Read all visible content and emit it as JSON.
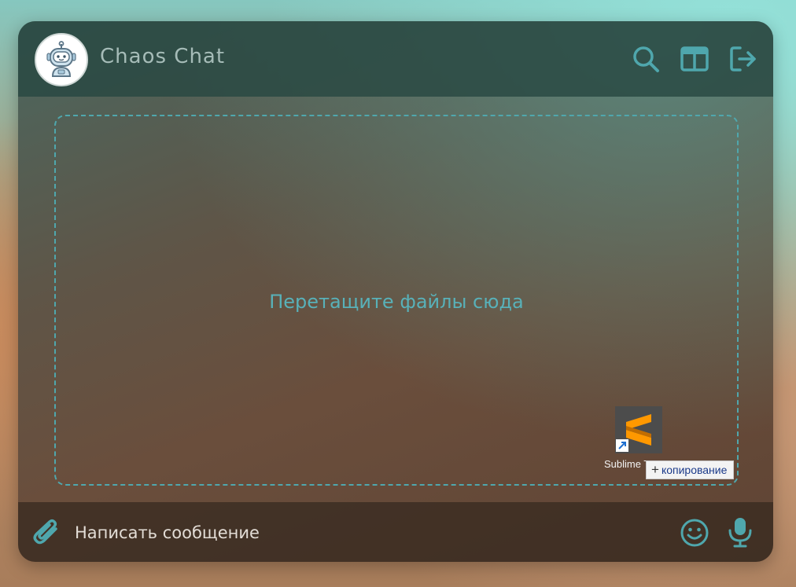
{
  "app": {
    "title": "Chaos Chat"
  },
  "header": {
    "icons": {
      "avatar": "robot-avatar",
      "search": "search-icon",
      "layout": "layout-icon",
      "logout": "logout-icon"
    }
  },
  "dropzone": {
    "text": "Перетащите файлы сюда"
  },
  "drag": {
    "icon": "sublime-text-shortcut-icon",
    "label": "Sublime T",
    "badge": "копирование",
    "badge_icon": "plus-icon"
  },
  "composer": {
    "placeholder": "Написать сообщение",
    "value": "",
    "icons": {
      "attach": "paperclip-icon",
      "emoji": "emoji-icon",
      "mic": "microphone-icon"
    }
  },
  "colors": {
    "accent": "#4fa7ad",
    "header_bg": "#284842",
    "footer_bg": "#34281e",
    "title": "#a6bcb8"
  }
}
